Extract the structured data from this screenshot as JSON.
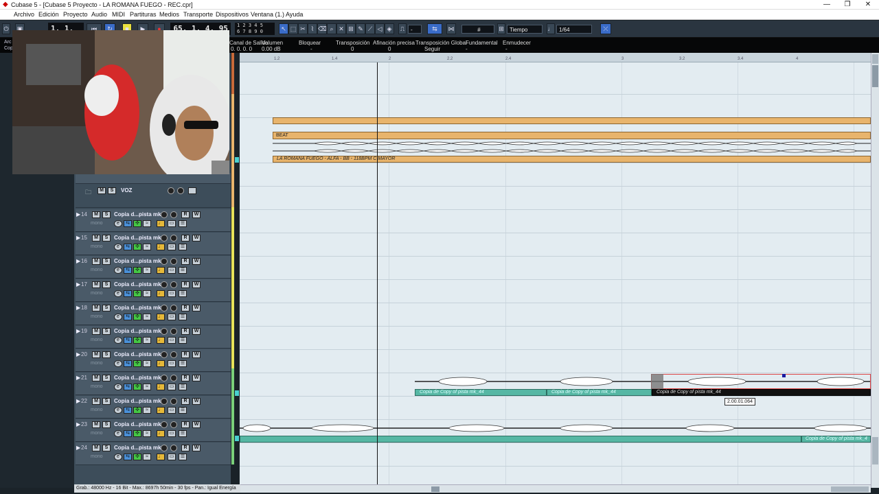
{
  "window": {
    "title": "Cubase 5 - [Cubase 5 Proyecto - LA ROMANA FUEGO - REC.cpr]",
    "minimize": "—",
    "maximize": "❐",
    "close": "✕"
  },
  "menu": [
    "Archivo",
    "Edición",
    "Proyecto",
    "Audio",
    "MIDI",
    "Partituras",
    "Medios",
    "Transporte",
    "Dispositivos",
    "Ventana (1.)",
    "Ayuda"
  ],
  "toolbar": {
    "left_position": "1. 1. 1.   0",
    "right_position": "65. 1. 4. 95",
    "keypad_top": "1 2 3 4 5",
    "keypad_bottom": "6 7 8 9 0",
    "snap_type": "Tiempo",
    "quantize": "1/64",
    "grid_value": "-"
  },
  "infoline": {
    "labels": [
      "Canal de Salida",
      "Volumen",
      "Bloquear",
      "Transposición",
      "Afinación precisa",
      "Transposición Global",
      "Fundamental",
      "Enmudecer"
    ],
    "values": [
      "0. 0. 0.   0",
      "0.00 dB",
      "-",
      "0",
      "0",
      "Seguir",
      "-",
      "-"
    ]
  },
  "left_pane": {
    "line1": "Arc",
    "line2": "Cop"
  },
  "ruler": {
    "ticks": [
      "1.2",
      "1.4",
      "2",
      "2.2",
      "2.4",
      "3",
      "3.2",
      "3.4",
      "4"
    ]
  },
  "folder_track": {
    "name": "VOZ",
    "m": "M",
    "s": "S"
  },
  "tracks": [
    {
      "num": "14",
      "name": "Copia d...pista mk",
      "sub": "mono"
    },
    {
      "num": "15",
      "name": "Copia d...pista mk",
      "sub": "mono"
    },
    {
      "num": "16",
      "name": "Copia d...pista mk",
      "sub": "mono"
    },
    {
      "num": "17",
      "name": "Copia d...pista mk",
      "sub": "mono"
    },
    {
      "num": "18",
      "name": "Copia d...pista mk",
      "sub": "mono"
    },
    {
      "num": "19",
      "name": "Copia d...pista mk",
      "sub": "mono"
    },
    {
      "num": "20",
      "name": "Copia d...pista mk",
      "sub": "mono"
    },
    {
      "num": "21",
      "name": "Copia d...pista mk",
      "sub": "mono"
    },
    {
      "num": "22",
      "name": "Copia d...pista mk",
      "sub": "mono"
    },
    {
      "num": "23",
      "name": "Copia d...pista mk",
      "sub": "mono"
    },
    {
      "num": "24",
      "name": "Copia d...pista mk",
      "sub": "mono"
    }
  ],
  "track_buttons": {
    "m": "M",
    "s": "S",
    "r": "R",
    "w": "W",
    "e": "e"
  },
  "parts": {
    "beat_label": "BEAT",
    "main_audio_label": "LA ROMANA FUEGO - ALFA - BB - 118BPM C MAYOR",
    "event_21a": "Copia de Copy of pista mk_44",
    "event_21b": "Copia de Copy of pista mk_44",
    "event_21c": "Copia de Copy of pista mk_44",
    "event_23": "Copia de Copy of pista mk_4"
  },
  "tooltip": "2.00.01.064",
  "status": "Grab.: 48000 Hz - 16 Bit - Max.: 8697h 50min - 30 fps - Pan.: Igual Energía",
  "colors": {
    "accent": "#3a6cc8",
    "event_teal": "#56b7a4",
    "part_orange": "#e8b46c",
    "arrange_bg": "#e3ecf1"
  }
}
